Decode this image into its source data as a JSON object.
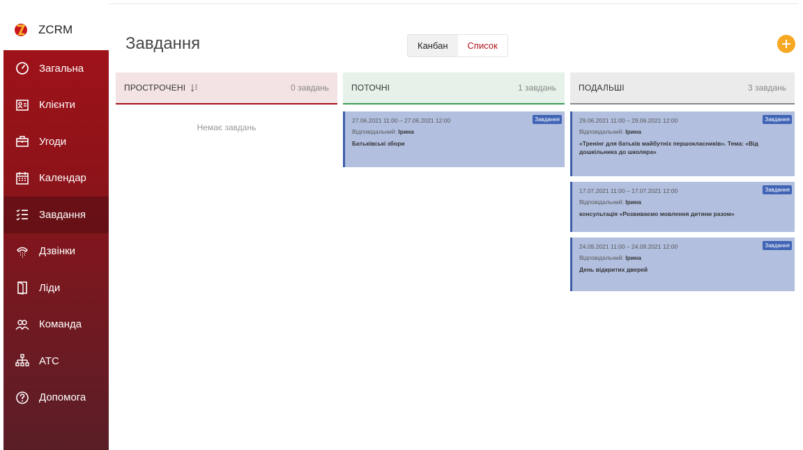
{
  "app": {
    "name": "ZCRM"
  },
  "sidebar": {
    "items": [
      {
        "label": "Загальна",
        "icon": "gauge-icon"
      },
      {
        "label": "Клієнти",
        "icon": "contact-card-icon"
      },
      {
        "label": "Угоди",
        "icon": "briefcase-icon"
      },
      {
        "label": "Календар",
        "icon": "calendar-icon"
      },
      {
        "label": "Завдання",
        "icon": "checklist-icon",
        "active": true
      },
      {
        "label": "Дзвінки",
        "icon": "phone-icon"
      },
      {
        "label": "Ліди",
        "icon": "door-icon"
      },
      {
        "label": "Команда",
        "icon": "team-icon"
      },
      {
        "label": "АТС",
        "icon": "network-icon"
      },
      {
        "label": "Допомога",
        "icon": "help-icon"
      }
    ]
  },
  "header": {
    "title": "Завдання",
    "views": {
      "kanban": "Канбан",
      "list": "Список",
      "active": "kanban"
    }
  },
  "colors": {
    "accent": "#b3121b",
    "add_button": "#f7a823",
    "overdue": "#a4121a",
    "current": "#3a9b58",
    "future": "#888888",
    "card": "#b2bfdf",
    "badge": "#3f63b5"
  },
  "columns": {
    "overdue": {
      "title": "ПРОСТРОЧЕНІ",
      "count": "0 завдань",
      "empty": "Немає завдань"
    },
    "current": {
      "title": "ПОТОЧНІ",
      "count": "1 завдань",
      "cards": [
        {
          "date": "27.06.2021 11:00 – 27.06.2021 12:00",
          "resp_label": "Відповідальний:",
          "resp_name": "Ірина",
          "title": "Батьківські збори",
          "badge": "Завдання"
        }
      ]
    },
    "future": {
      "title": "ПОДАЛЬШІ",
      "count": "3 завдань",
      "cards": [
        {
          "date": "29.06.2021 11:00 – 29.06.2021 12:00",
          "resp_label": "Відповідальний:",
          "resp_name": "Ірина",
          "title": "«Тренінг для батьків майбутніх першокласників». Тема: «Від дошкільника до школяра»",
          "badge": "Завдання"
        },
        {
          "date": "17.07.2021 11:00 – 17.07.2021 12:00",
          "resp_label": "Відповідальний:",
          "resp_name": "Ірина",
          "title": "консультація «Розвиваємо мовлення дитини разом»",
          "badge": "Завдання"
        },
        {
          "date": "24.09.2021 11:00 – 24.09.2021 12:00",
          "resp_label": "Відповідальний:",
          "resp_name": "Ірина",
          "title": "День відкритих дверей",
          "badge": "Завдання"
        }
      ]
    }
  }
}
